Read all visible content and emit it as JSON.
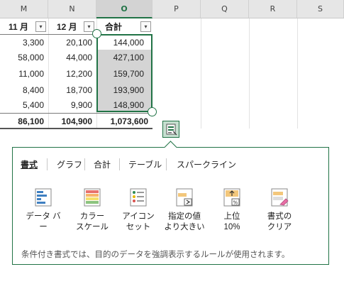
{
  "columns": [
    "M",
    "N",
    "O",
    "P",
    "Q",
    "R",
    "S"
  ],
  "headers": {
    "m": "11 月",
    "n": "12 月",
    "o": "合計",
    "filter_glyph": "▾"
  },
  "rows": [
    {
      "m": "3,300",
      "n": "20,100",
      "o": "144,000"
    },
    {
      "m": "58,000",
      "n": "44,000",
      "o": "427,100"
    },
    {
      "m": "11,000",
      "n": "12,200",
      "o": "159,700"
    },
    {
      "m": "8,400",
      "n": "18,700",
      "o": "193,900"
    },
    {
      "m": "5,400",
      "n": "9,900",
      "o": "148,900"
    }
  ],
  "totals": {
    "m": "86,100",
    "n": "104,900",
    "o": "1,073,600"
  },
  "quick_analysis": {
    "tabs": [
      "書式",
      "グラフ",
      "合計",
      "テーブル",
      "スパークライン"
    ],
    "active_tab": "書式",
    "tools": [
      {
        "line1": "データ バー",
        "line2": "",
        "icon": "data-bar-icon"
      },
      {
        "line1": "カラー",
        "line2": "スケール",
        "icon": "color-scale-icon"
      },
      {
        "line1": "アイコン",
        "line2": "セット",
        "icon": "icon-set-icon"
      },
      {
        "line1": "指定の値",
        "line2": "より大きい",
        "icon": "greater-than-icon"
      },
      {
        "line1": "上位",
        "line2": "10%",
        "icon": "top-ten-percent-icon"
      },
      {
        "line1": "書式の",
        "line2": "クリア",
        "icon": "clear-format-icon"
      }
    ],
    "description": "条件付き書式では、目的のデータを強調表示するルールが使用されます。"
  },
  "colors": {
    "accent": "#217346",
    "selection_fill": "#d4d4d4"
  }
}
